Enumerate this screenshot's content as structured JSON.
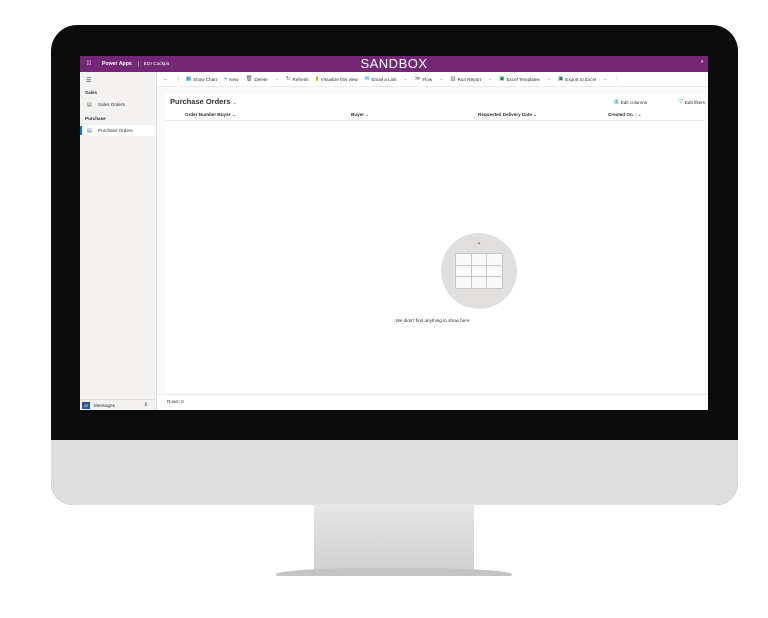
{
  "topbar": {
    "brand": "Power Apps",
    "app_name": "EDI Cockpit",
    "environment_banner": "SANDBOX",
    "waffle_icon": "waffle-icon",
    "search_icon": "search-icon",
    "color": "#742774"
  },
  "sidebar": {
    "groups": [
      {
        "label": "Sales",
        "items": [
          {
            "label": "Sales Orders",
            "icon": "list-icon"
          }
        ]
      },
      {
        "label": "Purchase",
        "items": [
          {
            "label": "Purchase Orders",
            "icon": "list-icon",
            "active": true
          }
        ]
      }
    ],
    "messages_badge": "M",
    "messages_label": "Messages"
  },
  "commandbar": {
    "show_chart": "Show Chart",
    "new": "New",
    "delete": "Delete",
    "refresh": "Refresh",
    "visualize": "Visualize this view",
    "email_link": "Email a Link",
    "flow": "Flow",
    "run_report": "Run Report",
    "excel_templates": "Excel Templates",
    "export_excel": "Export to Excel"
  },
  "view": {
    "title": "Purchase Orders",
    "edit_columns": "Edit columns",
    "edit_filters": "Edit filters",
    "columns": [
      "Order Number Buyer",
      "Buyer",
      "Requested Delivery Date",
      "Created On"
    ],
    "empty_message": "We didn't find anything to show here",
    "rows_label": "Rows: 0"
  }
}
